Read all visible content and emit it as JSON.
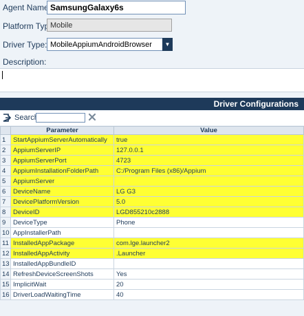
{
  "form": {
    "agent_name_label": "Agent Name:",
    "agent_name_value": "SamsungGalaxy6s",
    "platform_type_label": "Platform Type:",
    "platform_type_value": "Mobile",
    "driver_type_label": "Driver Type:",
    "driver_type_value": "MobileAppiumAndroidBrowser",
    "description_label": "Description:",
    "description_value": ""
  },
  "driver_config": {
    "title": "Driver Configurations",
    "search_label": "Search:",
    "search_value": "",
    "icons": {
      "export": "export-icon",
      "clear": "clear-search-icon"
    },
    "highlight_color": "#ffff33",
    "columns": [
      "Parameter",
      "Value"
    ],
    "rows": [
      {
        "num": "1",
        "param": "StartAppiumServerAutomatically",
        "value": "true",
        "highlighted": true
      },
      {
        "num": "2",
        "param": "AppiumServerIP",
        "value": "127.0.0.1",
        "highlighted": true
      },
      {
        "num": "3",
        "param": "AppiumServerPort",
        "value": "4723",
        "highlighted": true
      },
      {
        "num": "4",
        "param": "AppiumInstallationFolderPath",
        "value": "C:/Program Files (x86)/Appium",
        "highlighted": true
      },
      {
        "num": "5",
        "param": "AppiumServer",
        "value": "",
        "highlighted": true
      },
      {
        "num": "6",
        "param": "DeviceName",
        "value": "LG G3",
        "highlighted": true
      },
      {
        "num": "7",
        "param": "DevicePlatformVersion",
        "value": "5.0",
        "highlighted": true
      },
      {
        "num": "8",
        "param": "DeviceID",
        "value": "LGD855210c2888",
        "highlighted": true
      },
      {
        "num": "9",
        "param": "DeviceType",
        "value": "Phone",
        "highlighted": false
      },
      {
        "num": "10",
        "param": "AppInstallerPath",
        "value": "",
        "highlighted": false
      },
      {
        "num": "11",
        "param": "InstalledAppPackage",
        "value": "com.lge.launcher2",
        "highlighted": true
      },
      {
        "num": "12",
        "param": "InstalledAppActivity",
        "value": ".Launcher",
        "highlighted": true
      },
      {
        "num": "13",
        "param": "InstalledAppBundleID",
        "value": "",
        "highlighted": false
      },
      {
        "num": "14",
        "param": "RefreshDeviceScreenShots",
        "value": "Yes",
        "highlighted": false
      },
      {
        "num": "15",
        "param": "ImplicitWait",
        "value": "20",
        "highlighted": false
      },
      {
        "num": "16",
        "param": "DriverLoadWaitingTime",
        "value": "40",
        "highlighted": false
      }
    ]
  }
}
